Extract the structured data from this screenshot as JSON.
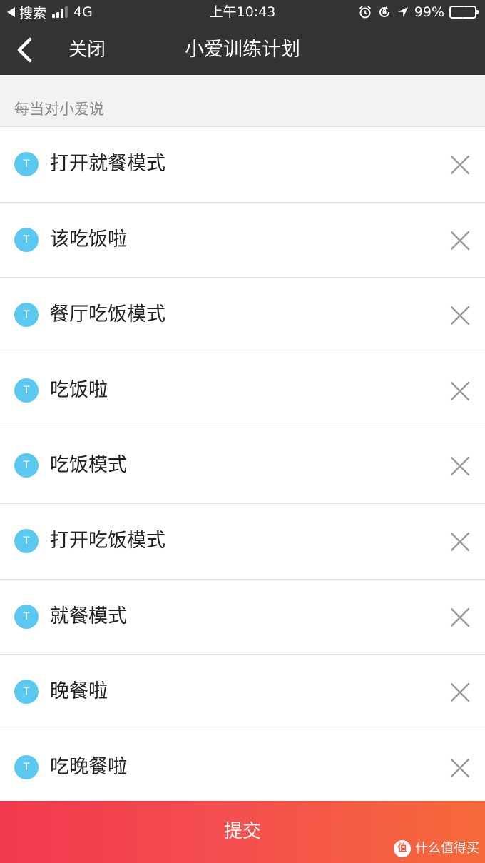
{
  "status_bar": {
    "back_app": "搜索",
    "network": "4G",
    "time": "上午10:43",
    "battery": "99%"
  },
  "nav": {
    "close_label": "关闭",
    "title": "小爱训练计划"
  },
  "section": {
    "header": "每当对小爱说"
  },
  "items": [
    {
      "icon_text": "T",
      "label": "打开就餐模式"
    },
    {
      "icon_text": "T",
      "label": "该吃饭啦"
    },
    {
      "icon_text": "T",
      "label": "餐厅吃饭模式"
    },
    {
      "icon_text": "T",
      "label": "吃饭啦"
    },
    {
      "icon_text": "T",
      "label": "吃饭模式"
    },
    {
      "icon_text": "T",
      "label": "打开吃饭模式"
    },
    {
      "icon_text": "T",
      "label": "就餐模式"
    },
    {
      "icon_text": "T",
      "label": "晚餐啦"
    },
    {
      "icon_text": "T",
      "label": "吃晚餐啦"
    }
  ],
  "submit_label": "提交",
  "watermark": {
    "logo_text": "值",
    "text": "什么值得买"
  },
  "colors": {
    "nav_bg": "#333333",
    "accent_blue": "#5bc8ef",
    "submit_start": "#f2394f",
    "submit_end": "#f66a3a"
  }
}
